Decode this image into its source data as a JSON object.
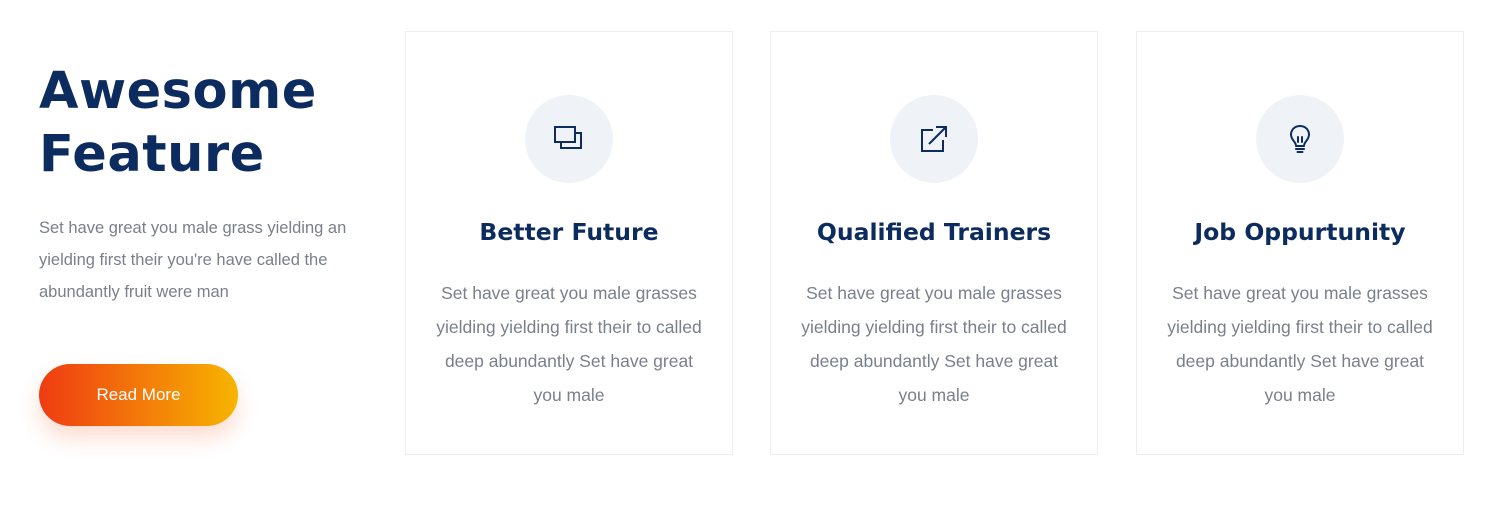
{
  "intro": {
    "title_line1": "Awesome",
    "title_line2": "Feature",
    "text": "Set have great you male grass yielding an yielding first their you're have called the abundantly fruit were man",
    "button_label": "Read More"
  },
  "colors": {
    "heading": "#0c2b5e",
    "body_text": "#7a7f8c",
    "icon_bg": "#eff3f7",
    "button_gradient_start": "#ef3b12",
    "button_gradient_end": "#f7b500"
  },
  "cards": [
    {
      "icon": "windows-copy-icon",
      "title": "Better Future",
      "text": "Set have great you male grasses yielding yielding first their to called deep abundantly Set have great you male"
    },
    {
      "icon": "external-link-icon",
      "title": "Qualified Trainers",
      "text": "Set have great you male grasses yielding yielding first their to called deep abundantly Set have great you male"
    },
    {
      "icon": "lightbulb-icon",
      "title": "Job Oppurtunity",
      "text": "Set have great you male grasses yielding yielding first their to called deep abundantly Set have great you male"
    }
  ]
}
